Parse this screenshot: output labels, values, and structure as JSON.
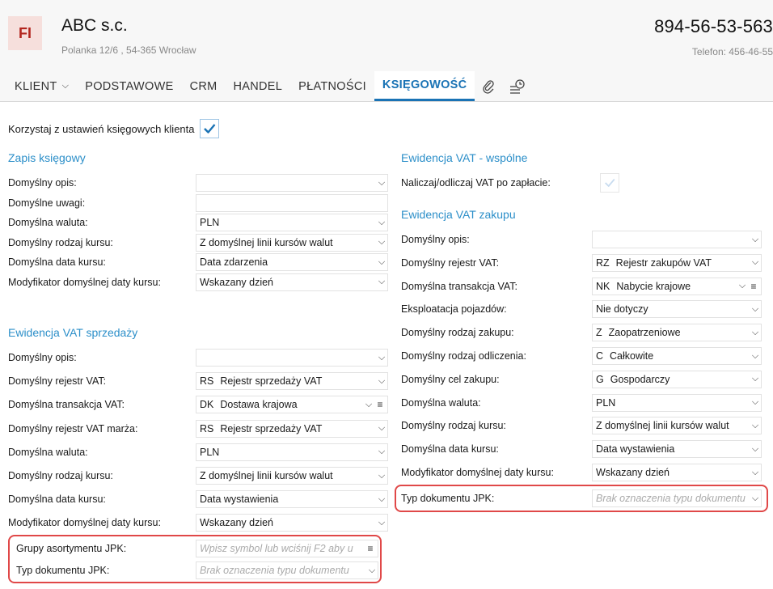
{
  "header": {
    "logo": "FI",
    "company_name": "ABC s.c.",
    "address": "Polanka 12/6 , 54-365 Wrocław",
    "nip": "894-56-53-563",
    "phone": "Telefon: 456-46-55"
  },
  "tabs": [
    {
      "label": "KLIENT"
    },
    {
      "label": "PODSTAWOWE"
    },
    {
      "label": "CRM"
    },
    {
      "label": "HANDEL"
    },
    {
      "label": "PŁATNOŚCI"
    },
    {
      "label": "KSIĘGOWOŚĆ"
    }
  ],
  "use_client_settings": {
    "label": "Korzystaj z ustawień księgowych klienta",
    "checked": true
  },
  "left": {
    "zapis_title": "Zapis księgowy",
    "zapis": [
      {
        "label": "Domyślny opis:",
        "value": ""
      },
      {
        "label": "Domyślne uwagi:",
        "value": ""
      },
      {
        "label": "Domyślna waluta:",
        "value": "PLN"
      },
      {
        "label": "Domyślny rodzaj kursu:",
        "value": "Z domyślnej linii kursów walut"
      },
      {
        "label": "Domyślna data kursu:",
        "value": "Data zdarzenia"
      },
      {
        "label": "Modyfikator domyślnej daty kursu:",
        "value": "Wskazany dzień"
      }
    ],
    "sprzedaz_title": "Ewidencja VAT sprzedaży",
    "sprzedaz": [
      {
        "label": "Domyślny opis:",
        "value": ""
      },
      {
        "label": "Domyślny rejestr VAT:",
        "code": "RS",
        "value": "Rejestr sprzedaży VAT"
      },
      {
        "label": "Domyślna transakcja VAT:",
        "code": "DK",
        "value": "Dostawa krajowa"
      },
      {
        "label": "Domyślny rejestr VAT marża:",
        "code": "RS",
        "value": "Rejestr sprzedaży VAT"
      },
      {
        "label": "Domyślna waluta:",
        "value": "PLN"
      },
      {
        "label": "Domyślny rodzaj kursu:",
        "value": "Z domyślnej linii kursów walut"
      },
      {
        "label": "Domyślna data kursu:",
        "value": "Data wystawienia"
      },
      {
        "label": "Modyfikator domyślnej daty kursu:",
        "value": "Wskazany dzień"
      }
    ],
    "jpk_groups": {
      "label": "Grupy asortymentu JPK:",
      "placeholder": "Wpisz symbol lub wciśnij F2 aby u"
    },
    "jpk_type": {
      "label": "Typ dokumentu JPK:",
      "placeholder": "Brak oznaczenia typu dokumentu"
    }
  },
  "right": {
    "wspolne_title": "Ewidencja VAT - wspólne",
    "naliczaj_label": "Naliczaj/odliczaj VAT po zapłacie:",
    "zakupu_title": "Ewidencja VAT zakupu",
    "zakupu": [
      {
        "label": "Domyślny opis:",
        "value": ""
      },
      {
        "label": "Domyślny rejestr VAT:",
        "code": "RZ",
        "value": "Rejestr zakupów VAT"
      },
      {
        "label": "Domyślna transakcja VAT:",
        "code": "NK",
        "value": "Nabycie krajowe"
      },
      {
        "label": "Eksploatacja pojazdów:",
        "value": "Nie dotyczy"
      },
      {
        "label": "Domyślny rodzaj zakupu:",
        "code": "Z",
        "value": "Zaopatrzeniowe"
      },
      {
        "label": "Domyślny rodzaj odliczenia:",
        "code": "C",
        "value": "Całkowite"
      },
      {
        "label": "Domyślny cel zakupu:",
        "code": "G",
        "value": "Gospodarczy"
      },
      {
        "label": "Domyślna waluta:",
        "value": "PLN"
      },
      {
        "label": "Domyślny rodzaj kursu:",
        "value": "Z domyślnej linii kursów walut"
      },
      {
        "label": "Domyślna data kursu:",
        "value": "Data wystawienia"
      },
      {
        "label": "Modyfikator domyślnej daty kursu:",
        "value": "Wskazany dzień"
      }
    ],
    "jpk_type": {
      "label": "Typ dokumentu JPK:",
      "placeholder": "Brak oznaczenia typu dokumentu"
    }
  },
  "colors": {
    "accent": "#1a73b5",
    "section": "#2c8fc9",
    "highlight": "#e04848"
  }
}
